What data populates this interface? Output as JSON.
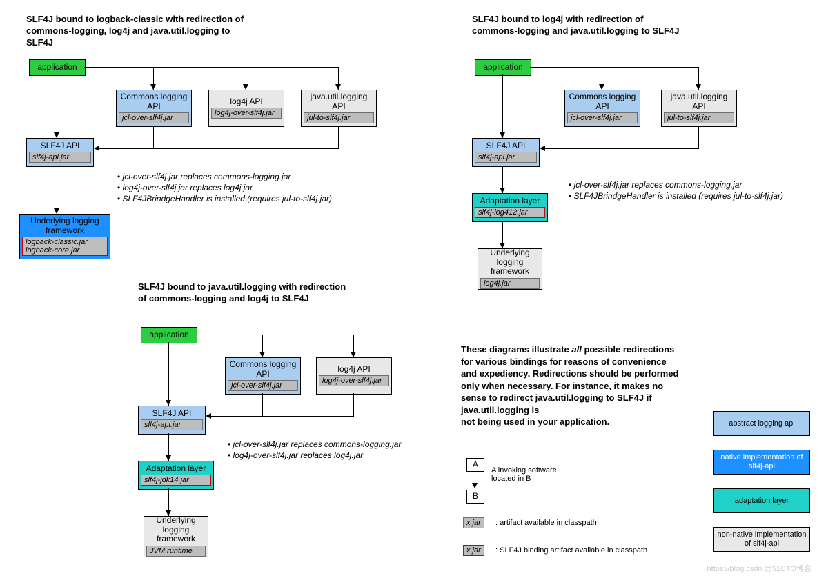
{
  "watermark": "https://blog.csdn  @51CTO博客",
  "d1": {
    "title": "SLF4J bound to logback-classic with redirection of commons-logging, log4j and java.util.logging to SLF4J",
    "app": "application",
    "commons": "Commons logging API",
    "commons_jar": "jcl-over-slf4j.jar",
    "log4j": "log4j API",
    "log4j_jar": "log4j-over-slf4j.jar",
    "jul": "java.util.logging API",
    "jul_jar": "jul-to-slf4j.jar",
    "slf4j": "SLF4J API",
    "slf4j_jar": "slf4j-api.jar",
    "under": "Underlying logging framework",
    "under_jar": "logback-classic.jar\nlogback-core.jar",
    "notes": [
      "jcl-over-slf4j.jar replaces commons-logging.jar",
      "log4j-over-slf4j.jar replaces log4j.jar",
      "SLF4JBrindgeHandler is installed (requires jul-to-slf4j.jar)"
    ]
  },
  "d2": {
    "title": "SLF4J bound to java.util.logging with redirection of commons-logging and log4j to SLF4J",
    "app": "application",
    "commons": "Commons logging API",
    "commons_jar": "jcl-over-slf4j.jar",
    "log4j": "log4j API",
    "log4j_jar": "log4j-over-slf4j.jar",
    "slf4j": "SLF4J API",
    "slf4j_jar": "slf4j-api.jar",
    "adapt": "Adaptation layer",
    "adapt_jar": "slf4j-jdk14.jar",
    "under": "Underlying logging framework",
    "under_jar": "JVM runtime",
    "notes": [
      "jcl-over-slf4j.jar replaces commons-logging.jar",
      "log4j-over-slf4j.jar replaces log4j.jar"
    ]
  },
  "d3": {
    "title": "SLF4J bound to log4j with redirection of commons-logging and java.util.logging to SLF4J",
    "app": "application",
    "commons": "Commons logging API",
    "commons_jar": "jcl-over-slf4j.jar",
    "jul": "java.util.logging API",
    "jul_jar": "jul-to-slf4j.jar",
    "slf4j": "SLF4J API",
    "slf4j_jar": "slf4j-api.jar",
    "adapt": "Adaptation layer",
    "adapt_jar": "slf4j-log412.jar",
    "under": "Underlying logging framework",
    "under_jar": "log4j.jar",
    "notes": [
      "jcl-over-slf4j.jar replaces commons-logging.jar",
      "SLF4JBrindgeHandler is installed (requires jul-to-slf4j.jar)"
    ]
  },
  "explain": {
    "p1": "These diagrams illustrate ",
    "p1i": "all",
    "p2": " possible redirections for various bindings for reasons of convenience and expediency. Redirections should be performed only when necessary. For instance, it makes no sense to redirect java.util.logging to SLF4J if java.util.logging is",
    "p3": "not being used in your application."
  },
  "legend": {
    "A": "A",
    "B": "B",
    "ab_text": "A invoking software located in B",
    "xjar": "x.jar",
    "xjar1": ": artifact available in classpath",
    "xjar2": ": SLF4J binding artifact available in classpath",
    "b1": "abstract logging api",
    "b2": "native implementation of slf4j-api",
    "b3": "adaptation layer",
    "b4": "non-native implementation of slf4j-api"
  }
}
